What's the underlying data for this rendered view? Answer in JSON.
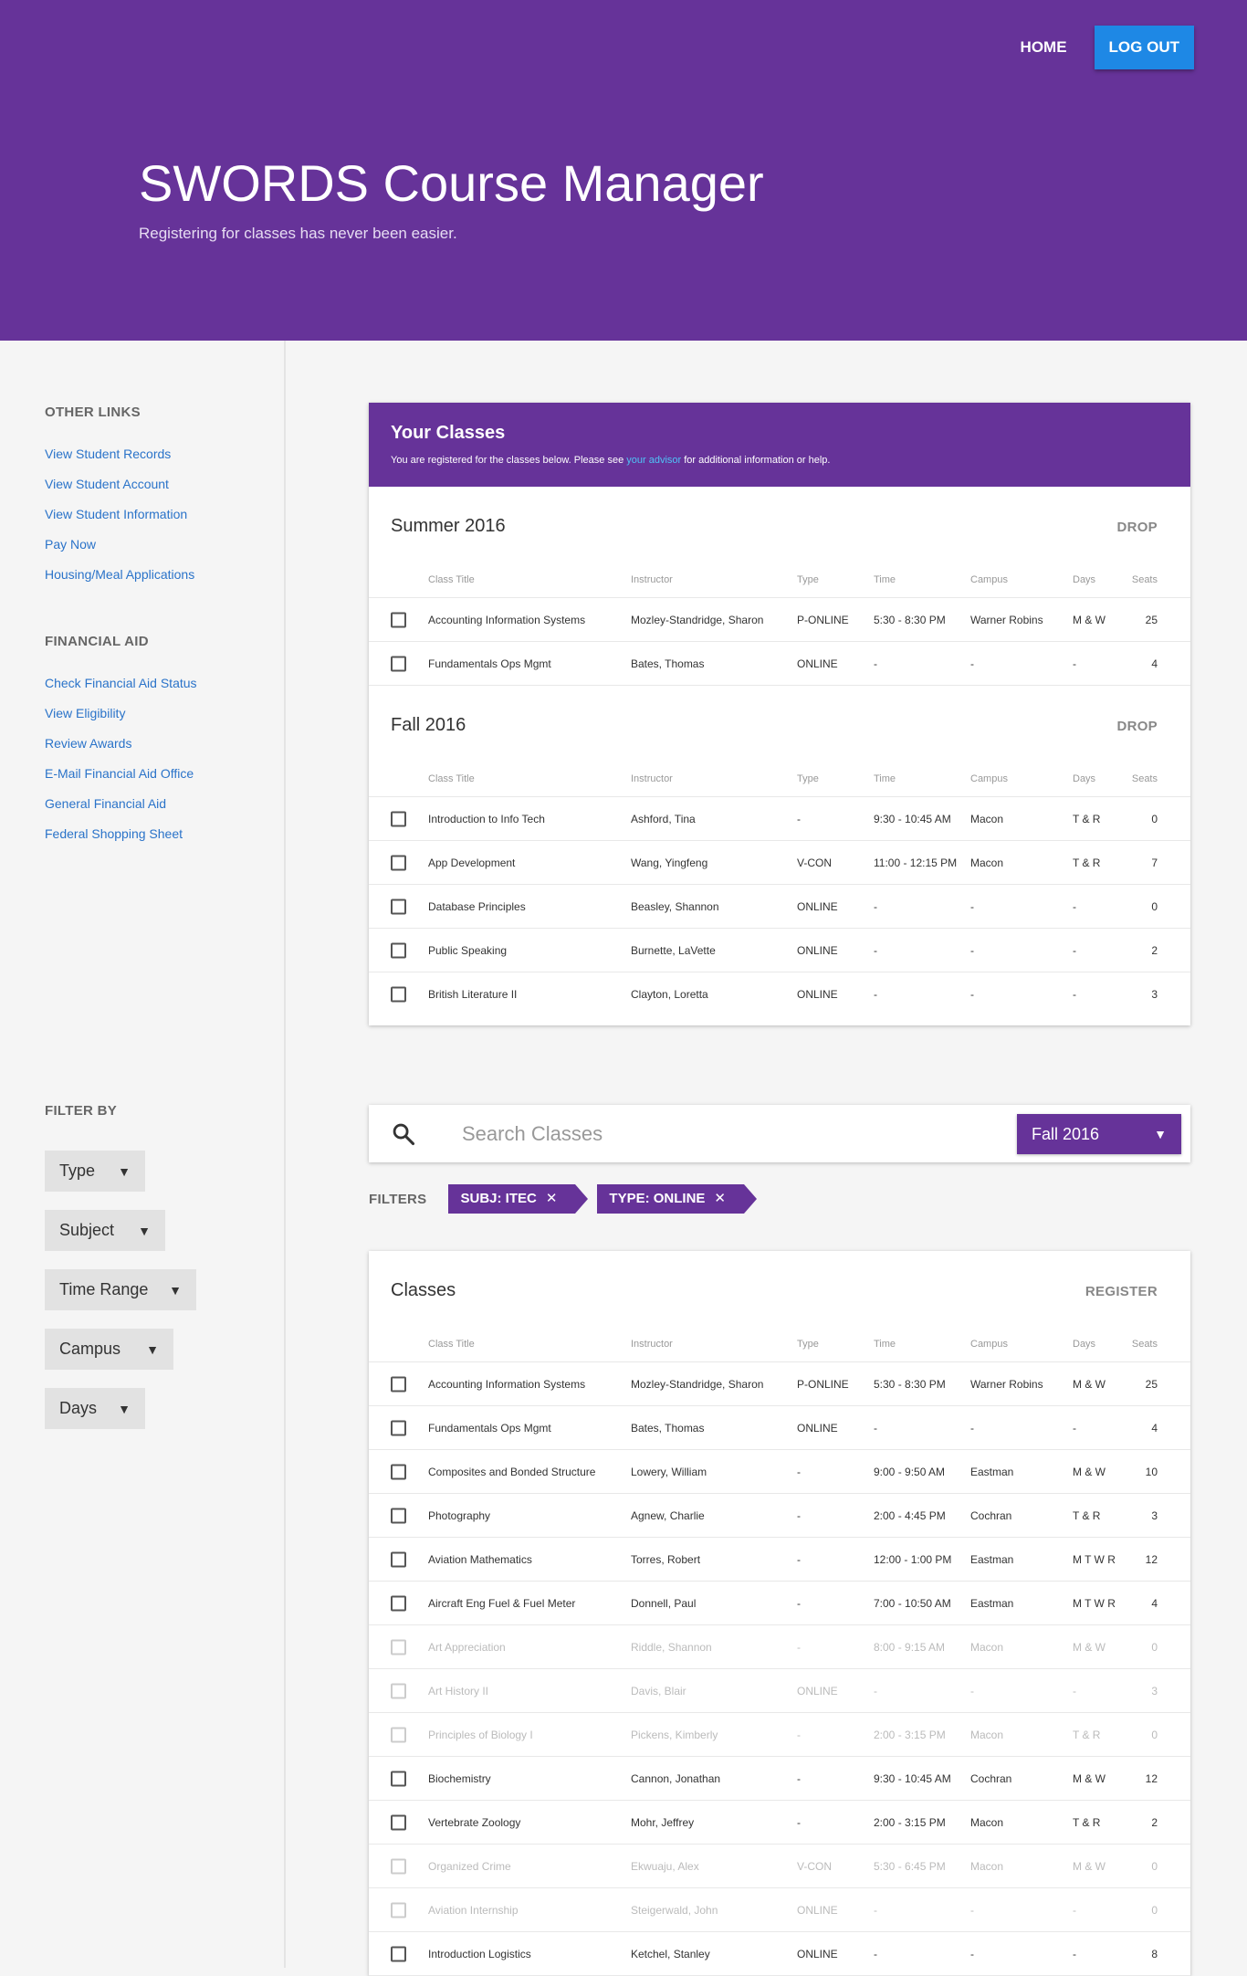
{
  "nav": {
    "home": "HOME",
    "logout": "LOG OUT"
  },
  "hero": {
    "title": "SWORDS Course Manager",
    "subtitle": "Registering for classes has never been easier."
  },
  "sidebar": {
    "other_links_heading": "OTHER LINKS",
    "other_links": [
      "View Student Records",
      "View Student Account",
      "View Student Information",
      "Pay Now",
      "Housing/Meal Applications"
    ],
    "financial_aid_heading": "FINANCIAL AID",
    "financial_aid_links": [
      "Check Financial Aid Status",
      "View Eligibility",
      "Review Awards",
      "E-Mail Financial Aid Office",
      "General Financial Aid",
      "Federal Shopping Sheet"
    ],
    "filter_heading": "FILTER BY",
    "filters": [
      "Type",
      "Subject",
      "Time Range",
      "Campus",
      "Days"
    ]
  },
  "your_classes": {
    "title": "Your Classes",
    "desc_before": "You are registered for the classes below. Please see ",
    "desc_link": "your advisor",
    "desc_after": " for additional information or help.",
    "columns": [
      "Class Title",
      "Instructor",
      "Type",
      "Time",
      "Campus",
      "Days",
      "Seats"
    ],
    "terms": [
      {
        "name": "Summer 2016",
        "action": "DROP",
        "rows": [
          [
            "Accounting Information Systems",
            "Mozley-Standridge, Sharon",
            "P-ONLINE",
            "5:30 - 8:30 PM",
            "Warner Robins",
            "M & W",
            "25"
          ],
          [
            "Fundamentals Ops Mgmt",
            "Bates, Thomas",
            "ONLINE",
            "-",
            "-",
            "-",
            "4"
          ]
        ]
      },
      {
        "name": "Fall 2016",
        "action": "DROP",
        "rows": [
          [
            "Introduction to Info Tech",
            "Ashford, Tina",
            "-",
            "9:30 - 10:45 AM",
            "Macon",
            "T & R",
            "0"
          ],
          [
            "App Development",
            "Wang, Yingfeng",
            "V-CON",
            "11:00 - 12:15 PM",
            "Macon",
            "T & R",
            "7"
          ],
          [
            "Database Principles",
            "Beasley, Shannon",
            "ONLINE",
            "-",
            "-",
            "-",
            "0"
          ],
          [
            "Public Speaking",
            "Burnette, LaVette",
            "ONLINE",
            "-",
            "-",
            "-",
            "2"
          ],
          [
            "British Literature II",
            "Clayton, Loretta",
            "ONLINE",
            "-",
            "-",
            "-",
            "3"
          ]
        ]
      }
    ]
  },
  "search": {
    "placeholder": "Search Classes",
    "term": "Fall 2016"
  },
  "filters": {
    "label": "FILTERS",
    "chips": [
      "SUBJ: ITEC",
      "TYPE: ONLINE"
    ]
  },
  "classes": {
    "title": "Classes",
    "action": "REGISTER",
    "rows": [
      {
        "cells": [
          "Accounting Information Systems",
          "Mozley-Standridge, Sharon",
          "P-ONLINE",
          "5:30 - 8:30 PM",
          "Warner Robins",
          "M & W",
          "25"
        ],
        "disabled": false
      },
      {
        "cells": [
          "Fundamentals Ops Mgmt",
          "Bates, Thomas",
          "ONLINE",
          "-",
          "-",
          "-",
          "4"
        ],
        "disabled": false
      },
      {
        "cells": [
          "Composites and Bonded Structure",
          "Lowery, William",
          "-",
          "9:00 - 9:50 AM",
          "Eastman",
          "M & W",
          "10"
        ],
        "disabled": false
      },
      {
        "cells": [
          "Photography",
          "Agnew, Charlie",
          "-",
          "2:00 - 4:45 PM",
          "Cochran",
          "T & R",
          "3"
        ],
        "disabled": false
      },
      {
        "cells": [
          "Aviation Mathematics",
          "Torres, Robert",
          "-",
          "12:00 - 1:00 PM",
          "Eastman",
          "M T W R",
          "12"
        ],
        "disabled": false
      },
      {
        "cells": [
          "Aircraft Eng Fuel & Fuel Meter",
          "Donnell, Paul",
          "-",
          "7:00 - 10:50 AM",
          "Eastman",
          "M T W R",
          "4"
        ],
        "disabled": false
      },
      {
        "cells": [
          "Art Appreciation",
          "Riddle, Shannon",
          "-",
          "8:00 - 9:15 AM",
          "Macon",
          "M & W",
          "0"
        ],
        "disabled": true
      },
      {
        "cells": [
          "Art History II",
          "Davis, Blair",
          "ONLINE",
          "-",
          "-",
          "-",
          "3"
        ],
        "disabled": true
      },
      {
        "cells": [
          "Principles of Biology I",
          "Pickens, Kimberly",
          "-",
          "2:00 - 3:15 PM",
          "Macon",
          "T & R",
          "0"
        ],
        "disabled": true
      },
      {
        "cells": [
          "Biochemistry",
          "Cannon, Jonathan",
          "-",
          "9:30 - 10:45 AM",
          "Cochran",
          "M & W",
          "12"
        ],
        "disabled": false
      },
      {
        "cells": [
          "Vertebrate Zoology",
          "Mohr, Jeffrey",
          "-",
          "2:00 - 3:15 PM",
          "Macon",
          "T & R",
          "2"
        ],
        "disabled": false
      },
      {
        "cells": [
          "Organized Crime",
          "Ekwuaju, Alex",
          "V-CON",
          "5:30 - 6:45 PM",
          "Macon",
          "M & W",
          "0"
        ],
        "disabled": true
      },
      {
        "cells": [
          "Aviation Internship",
          "Steigerwald, John",
          "ONLINE",
          "-",
          "-",
          "-",
          "0"
        ],
        "disabled": true
      },
      {
        "cells": [
          "Introduction Logistics",
          "Ketchel, Stanley",
          "ONLINE",
          "-",
          "-",
          "-",
          "8"
        ],
        "disabled": false
      }
    ]
  }
}
